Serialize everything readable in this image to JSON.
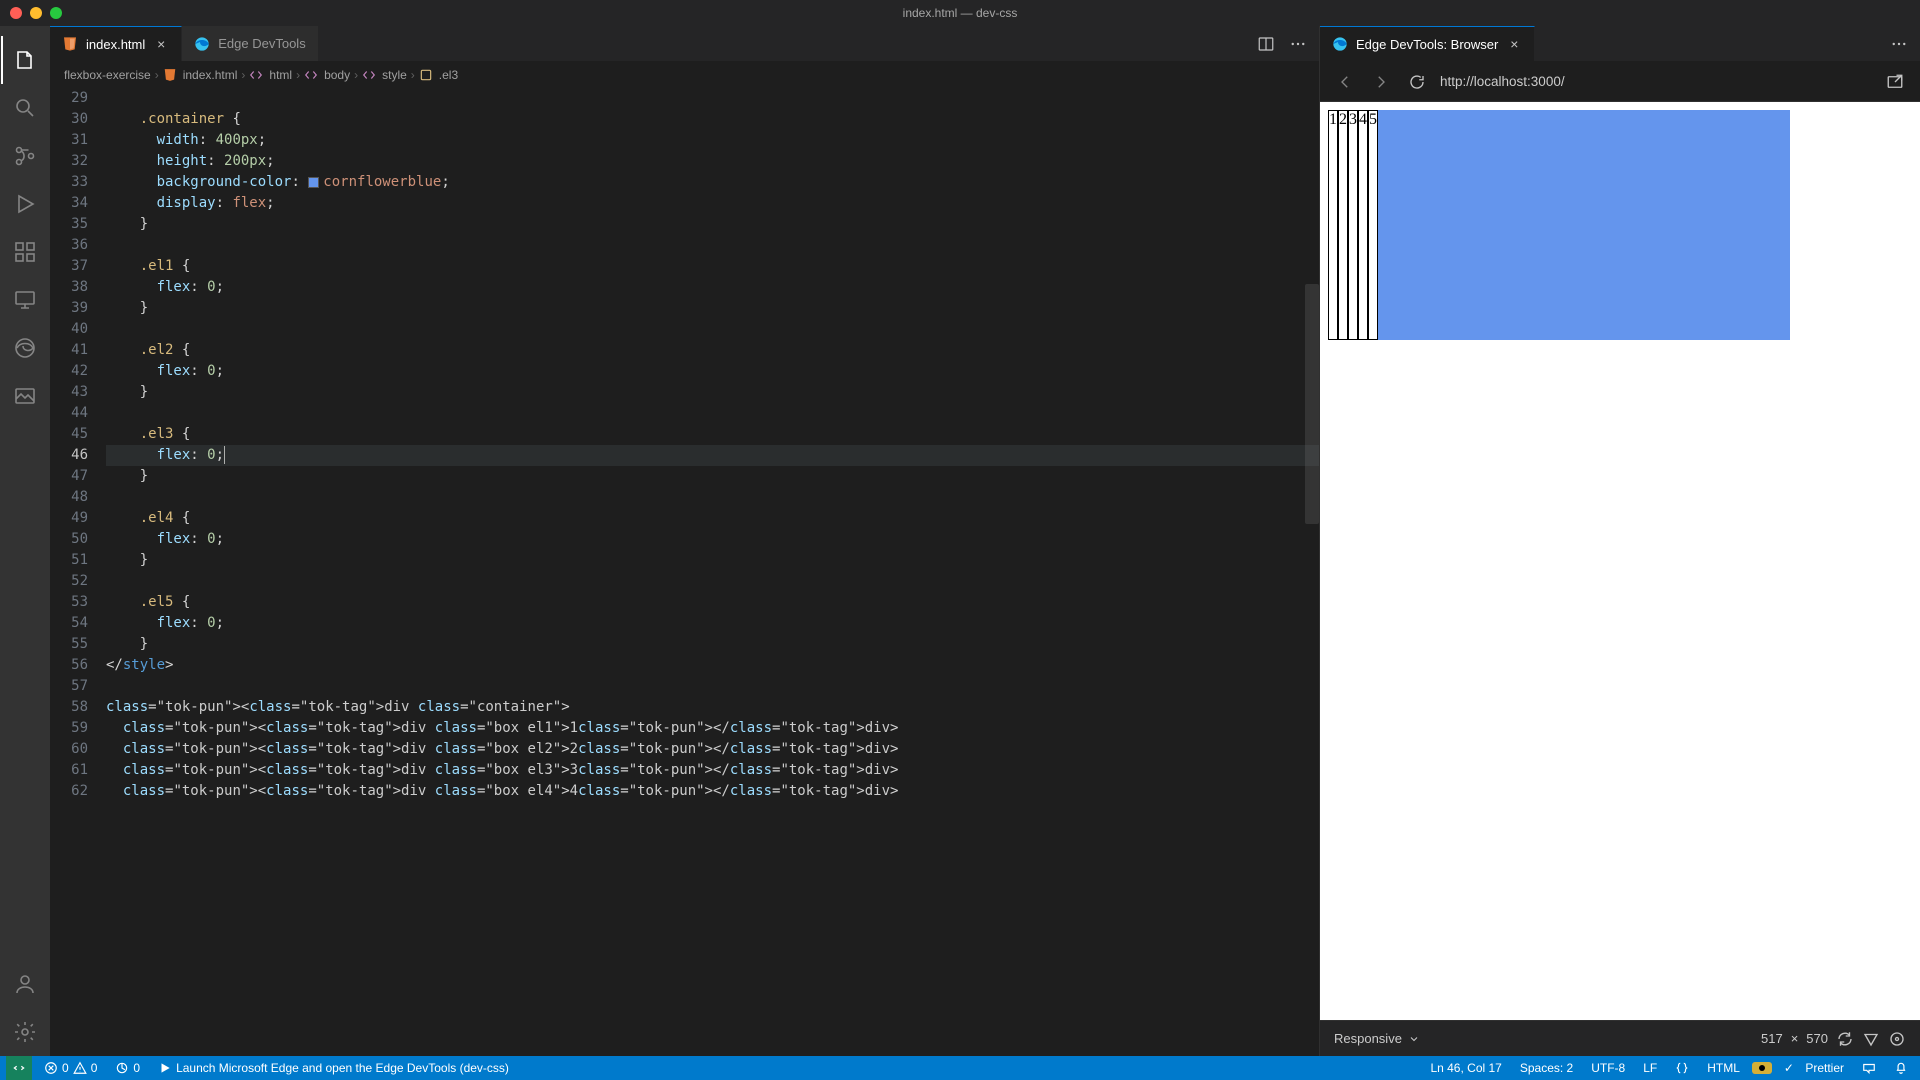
{
  "window": {
    "title": "index.html — dev-css"
  },
  "tabs": {
    "editor": [
      {
        "label": "index.html",
        "active": true,
        "closable": true,
        "icon": "html"
      },
      {
        "label": "Edge DevTools",
        "active": false,
        "closable": false,
        "icon": "edge"
      }
    ],
    "browser": [
      {
        "label": "Edge DevTools: Browser",
        "active": true,
        "closable": true,
        "icon": "edge"
      }
    ]
  },
  "breadcrumb": {
    "project": "flexbox-exercise",
    "file": "index.html",
    "htmlTag": "html",
    "bodyTag": "body",
    "styleTag": "style",
    "selector": ".el3"
  },
  "code": {
    "startLine": 29,
    "activeLine": 46,
    "lines": [
      "",
      "    .container {",
      "      width: 400px;",
      "      height: 200px;",
      "      background-color: cornflowerblue;",
      "      display: flex;",
      "    }",
      "",
      "    .el1 {",
      "      flex: 0;",
      "    }",
      "",
      "    .el2 {",
      "      flex: 0;",
      "    }",
      "",
      "    .el3 {",
      "      flex: 0;",
      "    }",
      "",
      "    .el4 {",
      "      flex: 0;",
      "    }",
      "",
      "    .el5 {",
      "      flex: 0;",
      "    }",
      "</style>",
      "",
      "<div class=\"container\">",
      "  <div class=\"box el1\">1</div>",
      "  <div class=\"box el2\">2</div>",
      "  <div class=\"box el3\">3</div>",
      "  <div class=\"box el4\">4</div>"
    ]
  },
  "browser": {
    "url": "http://localhost:3000/",
    "device": "Responsive",
    "width": "517",
    "height": "570"
  },
  "render": {
    "cells": [
      "1",
      "2",
      "3",
      "4",
      "5"
    ]
  },
  "status": {
    "errors": "0",
    "warnings": "0",
    "ports": "0",
    "launch": "Launch Microsoft Edge and open the Edge DevTools (dev-css)",
    "lncol": "Ln 46, Col 17",
    "spaces": "Spaces: 2",
    "encoding": "UTF-8",
    "eol": "LF",
    "lang": "HTML",
    "prettier": "Prettier"
  }
}
